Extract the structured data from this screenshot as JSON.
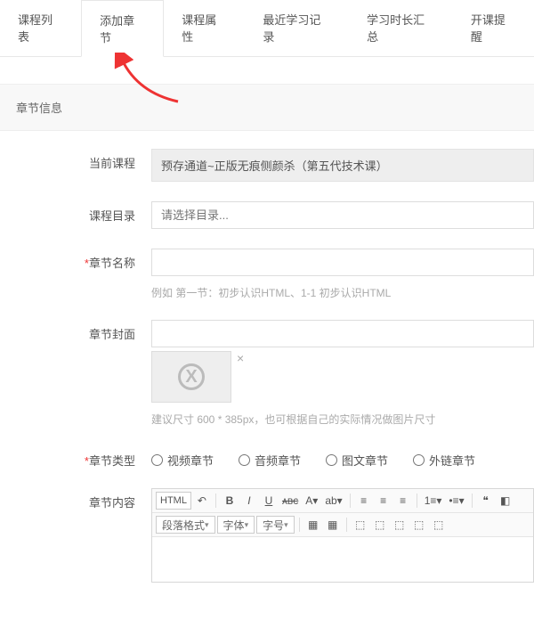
{
  "tabs": {
    "t0": "课程列表",
    "t1": "添加章节",
    "t2": "课程属性",
    "t3": "最近学习记录",
    "t4": "学习时长汇总",
    "t5": "开课提醒"
  },
  "section_header": "章节信息",
  "labels": {
    "current_course": "当前课程",
    "course_dir": "课程目录",
    "chapter_name": "章节名称",
    "chapter_cover": "章节封面",
    "chapter_type": "章节类型",
    "chapter_content": "章节内容"
  },
  "current_course_value": "预存通道~正版无痕侧颜杀（第五代技术课）",
  "course_dir_placeholder": "请选择目录...",
  "chapter_name_hint": "例如 第一节：初步认识HTML、1-1 初步认识HTML",
  "cover_hint": "建议尺寸 600 * 385px，也可根据自己的实际情况做图片尺寸",
  "chapter_types": {
    "video": "视频章节",
    "audio": "音频章节",
    "image_text": "图文章节",
    "external": "外链章节"
  },
  "editor_toolbar": {
    "html": "HTML",
    "para_format": "段落格式",
    "font_family": "字体",
    "font_size": "字号"
  }
}
